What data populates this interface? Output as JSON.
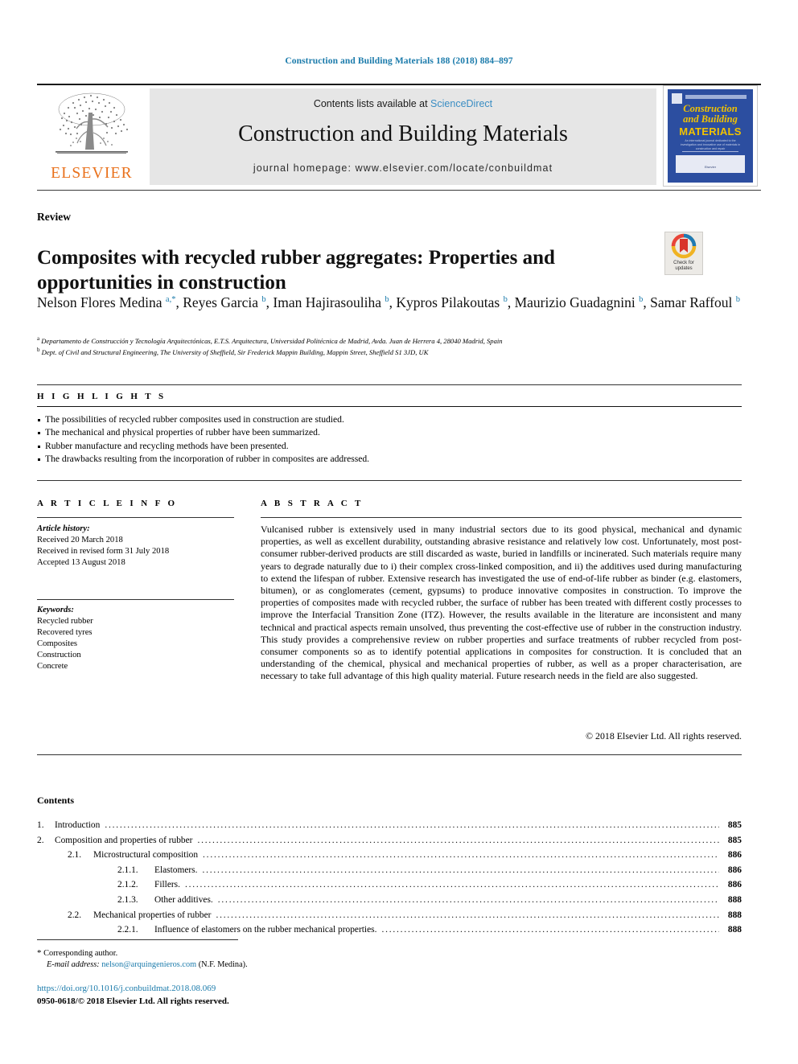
{
  "running_head": "Construction and Building Materials 188 (2018) 884–897",
  "masthead": {
    "contents_prefix": "Contents lists available at ",
    "sciencedirect": "ScienceDirect",
    "journal_name": "Construction and Building Materials",
    "homepage": "journal homepage: www.elsevier.com/locate/conbuildmat",
    "publisher_name": "ELSEVIER",
    "cover": {
      "title_line1": "Construction",
      "title_line2": "and Building",
      "title_line3": "MATERIALS",
      "blurb": "An international journal dedicated to the investigation and innovative use of materials in construction and repair",
      "footer": "Elsevier"
    }
  },
  "article": {
    "doctype": "Review",
    "title": "Composites with recycled rubber aggregates: Properties and opportunities in construction",
    "crossmark_line1": "Check for",
    "crossmark_line2": "updates",
    "authors_html": "Nelson Flores Medina <sup>a,*</sup>, Reyes Garcia <sup>b</sup>, Iman Hajirasouliha <sup>b</sup>, Kypros Pilakoutas <sup>b</sup>, Maurizio Guadagnini <sup>b</sup>, Samar Raffoul <sup>b</sup>",
    "affiliation_a": "Departamento de Construcción y Tecnología Arquitectónicas, E.T.S. Arquitectura, Universidad Politécnica de Madrid, Avda. Juan de Herrera 4, 28040 Madrid, Spain",
    "affiliation_b": "Dept. of Civil and Structural Engineering, The University of Sheffield, Sir Frederick Mappin Building, Mappin Street, Sheffield S1 3JD, UK"
  },
  "highlights": {
    "label": "H I G H L I G H T S",
    "items": [
      "The possibilities of recycled rubber composites used in construction are studied.",
      "The mechanical and physical properties of rubber have been summarized.",
      "Rubber manufacture and recycling methods have been presented.",
      "The drawbacks resulting from the incorporation of rubber in composites are addressed."
    ]
  },
  "article_info": {
    "label": "A R T I C L E   I N F O",
    "history_label": "Article history:",
    "history": [
      "Received 20 March 2018",
      "Received in revised form 31 July 2018",
      "Accepted 13 August 2018"
    ],
    "keywords_label": "Keywords:",
    "keywords": [
      "Recycled rubber",
      "Recovered tyres",
      "Composites",
      "Construction",
      "Concrete"
    ]
  },
  "abstract": {
    "label": "A B S T R A C T",
    "text": "Vulcanised rubber is extensively used in many industrial sectors due to its good physical, mechanical and dynamic properties, as well as excellent durability, outstanding abrasive resistance and relatively low cost. Unfortunately, most post-consumer rubber-derived products are still discarded as waste, buried in landfills or incinerated. Such materials require many years to degrade naturally due to i) their complex cross-linked composition, and ii) the additives used during manufacturing to extend the lifespan of rubber. Extensive research has investigated the use of end-of-life rubber as binder (e.g. elastomers, bitumen), or as conglomerates (cement, gypsums) to produce innovative composites in construction. To improve the properties of composites made with recycled rubber, the surface of rubber has been treated with different costly processes to improve the Interfacial Transition Zone (ITZ). However, the results available in the literature are inconsistent and many technical and practical aspects remain unsolved, thus preventing the cost-effective use of rubber in the construction industry. This study provides a comprehensive review on rubber properties and surface treatments of rubber recycled from post-consumer components so as to identify potential applications in composites for construction. It is concluded that an understanding of the chemical, physical and mechanical properties of rubber, as well as a proper characterisation, are necessary to take full advantage of this high quality material. Future research needs in the field are also suggested.",
    "copyright": "© 2018 Elsevier Ltd. All rights reserved."
  },
  "contents": {
    "title": "Contents",
    "entries": [
      {
        "level": 1,
        "num": "1.",
        "text": "Introduction",
        "page": "885"
      },
      {
        "level": 1,
        "num": "2.",
        "text": "Composition and properties of rubber",
        "page": "885"
      },
      {
        "level": 2,
        "num": "2.1.",
        "text": "Microstructural composition",
        "page": "886"
      },
      {
        "level": 3,
        "num": "2.1.1.",
        "text": "Elastomers.",
        "page": "886"
      },
      {
        "level": 3,
        "num": "2.1.2.",
        "text": "Fillers.",
        "page": "886"
      },
      {
        "level": 3,
        "num": "2.1.3.",
        "text": "Other additives.",
        "page": "888"
      },
      {
        "level": 2,
        "num": "2.2.",
        "text": "Mechanical properties of rubber",
        "page": "888"
      },
      {
        "level": 3,
        "num": "2.2.1.",
        "text": "Influence of elastomers on the rubber mechanical properties.",
        "page": "888"
      }
    ]
  },
  "footer": {
    "corresponding_star": "*",
    "corresponding_text": "Corresponding author.",
    "email_label": "E-mail address:",
    "email": "nelson@arquingenieros.com",
    "email_suffix": "(N.F. Medina).",
    "doi": "https://doi.org/10.1016/j.conbuildmat.2018.08.069",
    "issn": "0950-0618/© 2018 Elsevier Ltd. All rights reserved."
  },
  "colors": {
    "link": "#1b7bab",
    "sciencedirect": "#3a8dc3",
    "elsevier_orange": "#E9711C",
    "cover_blue": "#2c4ea0",
    "cover_yellow": "#f2c200"
  }
}
